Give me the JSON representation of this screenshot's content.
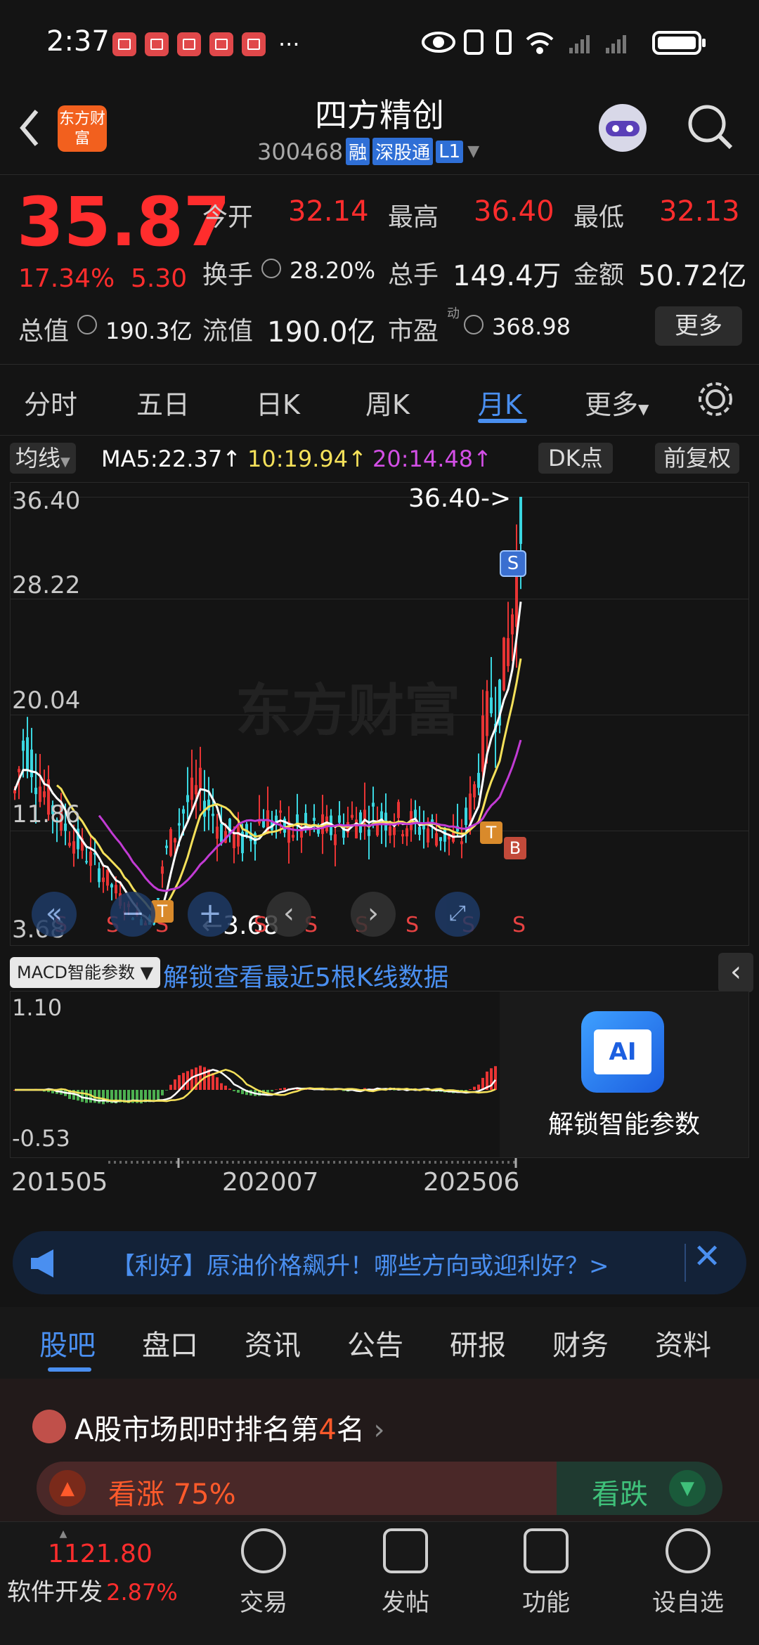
{
  "status_bar": {
    "time": "2:37",
    "dots": "···"
  },
  "header": {
    "logo_text": "东方财富",
    "stock_name": "四方精创",
    "stock_code": "300468",
    "tags": [
      "融",
      "深股通",
      "L1"
    ]
  },
  "quote": {
    "price": "35.87",
    "change_pct": "17.34%",
    "change": "5.30",
    "fields": [
      {
        "label": "今开",
        "value": "32.14"
      },
      {
        "label": "最高",
        "value": "36.40"
      },
      {
        "label": "最低",
        "value": "32.13"
      },
      {
        "label": "换手",
        "value": "28.20%"
      },
      {
        "label": "总手",
        "value": "149.4万"
      },
      {
        "label": "金额",
        "value": "50.72亿"
      },
      {
        "label": "总值",
        "value": "190.3亿"
      },
      {
        "label": "流值",
        "value": "190.0亿"
      },
      {
        "label": "市盈",
        "value": "368.98",
        "sup": "动"
      }
    ],
    "more_button": "更多"
  },
  "kline_tabs": [
    "分时",
    "五日",
    "日K",
    "周K",
    "月K",
    "更多"
  ],
  "kline_tab_active": "月K",
  "ma_bar": {
    "selector": "均线",
    "ma5": "MA5:22.37",
    "ma10": "10:19.94",
    "ma20": "20:14.48",
    "dk_button": "DK点",
    "adjust_button": "前复权"
  },
  "chart_data": {
    "type": "candlestick",
    "y_labels": [
      "36.40",
      "28.22",
      "20.04",
      "11.86",
      "3.68"
    ],
    "ylim": [
      3.68,
      36.4
    ],
    "high_marker": "36.40->",
    "low_marker": "3.68",
    "signal_labels": [
      "S",
      "S",
      "S",
      "S",
      "S",
      "S",
      "S",
      "S",
      "S"
    ],
    "badges": [
      "S",
      "T",
      "T",
      "B"
    ],
    "macd": {
      "selector": "MACD智能参数",
      "unlock_text": "解锁查看最近5根K线数据",
      "y_top": "1.10",
      "y_bottom": "-0.53",
      "ai_label": "AI",
      "ai_text": "解锁智能参数"
    },
    "x_labels": [
      "201505",
      "202007",
      "202506"
    ],
    "colors": {
      "up": "#e83434",
      "down": "#3ad6e0",
      "ma5": "#ffffff",
      "ma10": "#f5e15a",
      "ma20": "#c23bd4",
      "macd_up": "#e83434",
      "macd_down": "#4caf50"
    }
  },
  "news": {
    "text": "【利好】原油价格飙升！哪些方向或迎利好？>"
  },
  "bottom_tabs": [
    "股吧",
    "盘口",
    "资讯",
    "公告",
    "研报",
    "财务",
    "资料"
  ],
  "bottom_tab_active": "股吧",
  "ranking": {
    "text_before": "A股市场即时排名第",
    "rank": "4",
    "text_after": "名",
    "bull": "看涨 75%",
    "bear": "看跌"
  },
  "nav": {
    "index_value": "1121.80",
    "index_name": "软件开发",
    "index_change": "2.87%",
    "items": [
      "交易",
      "发帖",
      "功能",
      "设自选"
    ]
  }
}
